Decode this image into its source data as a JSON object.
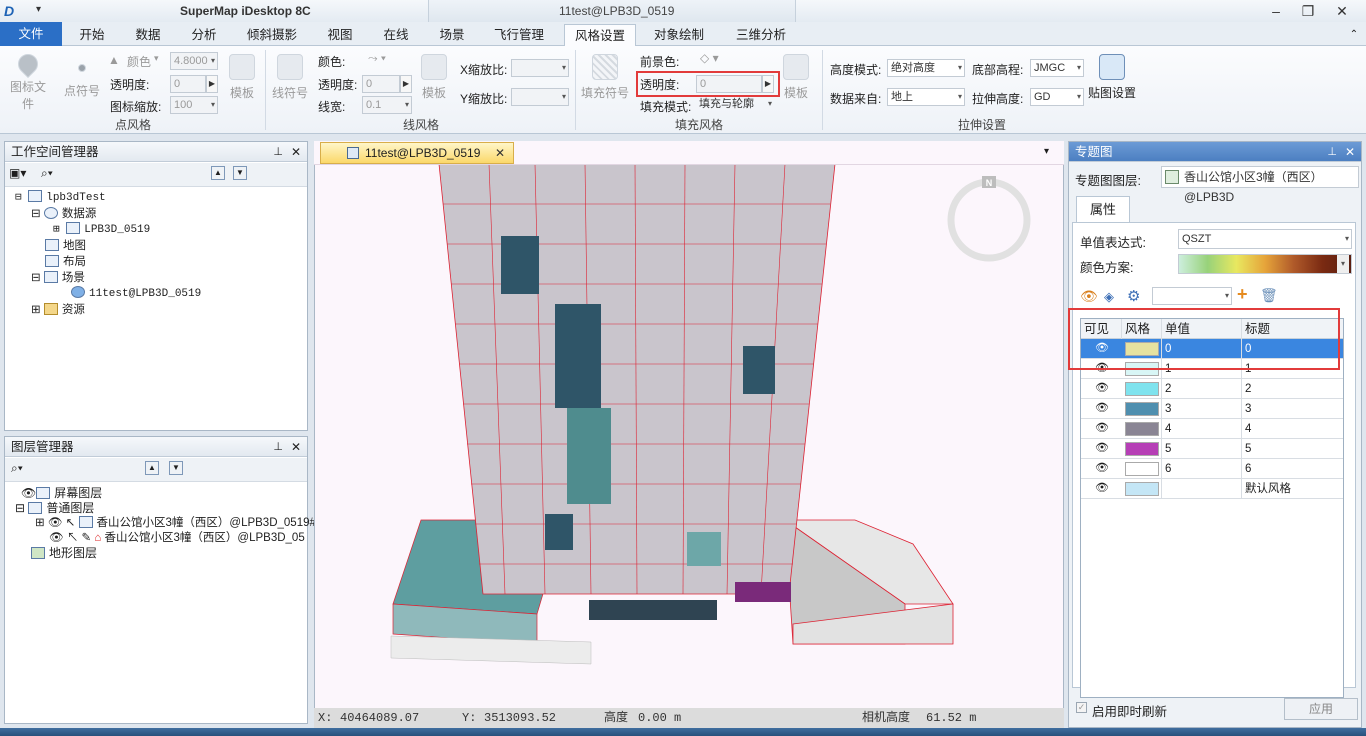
{
  "app": {
    "title": "SuperMap iDesktop 8C",
    "context_title": "11test@LPB3D_0519"
  },
  "tabs": [
    "文件",
    "开始",
    "数据",
    "分析",
    "倾斜摄影",
    "视图",
    "在线",
    "场景",
    "飞行管理",
    "风格设置",
    "对象绘制",
    "三维分析"
  ],
  "active_tab": "风格设置",
  "ribbon": {
    "point_group": {
      "label": "点风格",
      "btn_icon_file": "图标文件",
      "btn_point_symbol": "点符号",
      "color_label": "颜色",
      "color_value": "4.8000",
      "transparency_label": "透明度:",
      "transparency_value": "0",
      "scale_label": "图标缩放:",
      "scale_value": "100",
      "template": "模板"
    },
    "line_group": {
      "label": "线风格",
      "btn_line_symbol": "线符号",
      "color_label": "颜色:",
      "transparency_label": "透明度:",
      "transparency_value": "0",
      "width_label": "线宽:",
      "width_value": "0.1",
      "template": "模板",
      "x_scale_label": "X缩放比:",
      "y_scale_label": "Y缩放比:"
    },
    "fill_group": {
      "label": "填充风格",
      "btn_fill_symbol": "填充符号",
      "fg_color_label": "前景色:",
      "transparency_label": "透明度:",
      "transparency_value": "0",
      "fill_mode_label": "填充模式:",
      "fill_mode_value": "填充与轮廓",
      "template": "模板"
    },
    "extrude_group": {
      "label": "拉伸设置",
      "height_mode_label": "高度模式:",
      "height_mode_value": "绝对高度",
      "base_label": "底部高程:",
      "base_value": "JMGC",
      "data_from_label": "数据来自:",
      "data_from_value": "地上",
      "extrude_label": "拉伸高度:",
      "extrude_value": "GD",
      "texture_btn": "贴图设置"
    }
  },
  "workspace": {
    "title": "工作空间管理器",
    "items": [
      {
        "label": "lpb3dTest",
        "mono": true
      },
      {
        "label": "数据源",
        "mono": false
      },
      {
        "label": "LPB3D_0519",
        "mono": true
      },
      {
        "label": "地图",
        "mono": false
      },
      {
        "label": "布局",
        "mono": false
      },
      {
        "label": "场景",
        "mono": false
      },
      {
        "label": "11test@LPB3D_0519",
        "mono": true
      },
      {
        "label": "资源",
        "mono": false
      }
    ]
  },
  "layers": {
    "title": "图层管理器",
    "items": [
      {
        "label": "屏幕图层"
      },
      {
        "label": "普通图层"
      },
      {
        "label": "香山公馆小区3幢（西区）@LPB3D_0519#"
      },
      {
        "label": "香山公馆小区3幢（西区）@LPB3D_05"
      },
      {
        "label": "地形图层"
      }
    ]
  },
  "document_tab": {
    "label": "11test@LPB3D_0519"
  },
  "compass": {
    "label": "N"
  },
  "status": {
    "x_label": "X:",
    "x_value": "40464089.07",
    "y_label": "Y:",
    "y_value": "3513093.52",
    "height_label": "高度",
    "height_value": "0.00 m",
    "cam_label": "相机高度",
    "cam_value": "61.52 m"
  },
  "thematic": {
    "title": "专题图",
    "layer_label": "专题图图层:",
    "layer_value": "香山公馆小区3幢（西区）@LPB3D",
    "props_tab": "属性",
    "expr_label": "单值表达式:",
    "expr_value": "QSZT",
    "color_scheme_label": "颜色方案:",
    "columns": [
      "可见",
      "风格",
      "单值",
      "标题"
    ],
    "rows": [
      {
        "value": "0",
        "title": "0",
        "color": "#e6e2a0",
        "selected": true
      },
      {
        "value": "1",
        "title": "1",
        "color": "#d8f6f6",
        "selected": false
      },
      {
        "value": "2",
        "title": "2",
        "color": "#7fe3ee",
        "selected": false
      },
      {
        "value": "3",
        "title": "3",
        "color": "#4f8faf",
        "selected": false
      },
      {
        "value": "4",
        "title": "4",
        "color": "#8a8594",
        "selected": false
      },
      {
        "value": "5",
        "title": "5",
        "color": "#b63fb6",
        "selected": false
      },
      {
        "value": "6",
        "title": "6",
        "color": "#ffffff",
        "selected": false
      },
      {
        "value": "",
        "title": "默认风格",
        "color": "#c4e6f6",
        "selected": false
      }
    ],
    "auto_refresh_label": "启用即时刷新",
    "apply_label": "应用"
  }
}
